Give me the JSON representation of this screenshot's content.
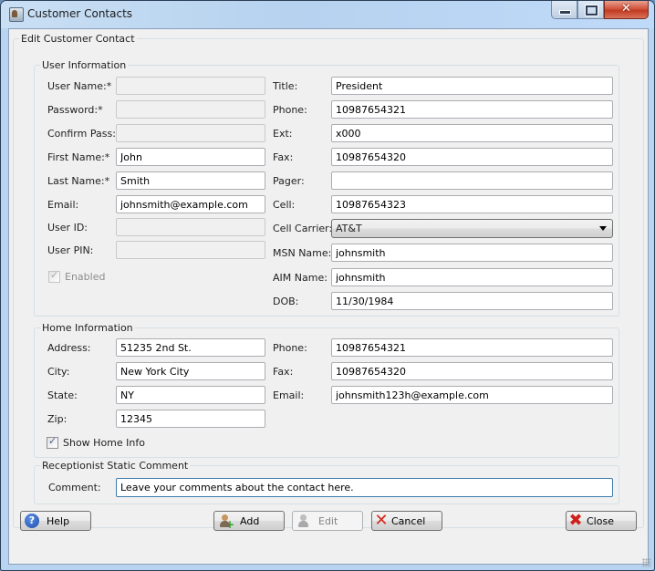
{
  "window": {
    "title": "Customer Contacts",
    "icon": "contacts-app-icon",
    "controls": {
      "minimize": "minimize-icon",
      "maximize": "maximize-icon",
      "close": "close-icon",
      "close_glyph": "✕"
    }
  },
  "main_group": {
    "legend": "Edit Customer Contact"
  },
  "user_info": {
    "legend": "User Information",
    "left_fields": [
      {
        "label": "User Name:*",
        "value": "",
        "enabled": false
      },
      {
        "label": "Password:*",
        "value": "",
        "enabled": false
      },
      {
        "label": "Confirm Pass:*",
        "value": "",
        "enabled": false
      },
      {
        "label": "First Name:*",
        "value": "John",
        "enabled": true
      },
      {
        "label": "Last Name:*",
        "value": "Smith",
        "enabled": true
      },
      {
        "label": "Email:",
        "value": "johnsmith@example.com",
        "enabled": true
      },
      {
        "label": "User ID:",
        "value": "",
        "enabled": false
      },
      {
        "label": "User PIN:",
        "value": "",
        "enabled": false
      }
    ],
    "enabled_checkbox": {
      "label": "Enabled",
      "checked": true,
      "disabled": true
    },
    "right_fields": [
      {
        "label": "Title:",
        "value": "President"
      },
      {
        "label": "Phone:",
        "value": "10987654321"
      },
      {
        "label": "Ext:",
        "value": "x000"
      },
      {
        "label": "Fax:",
        "value": "10987654320"
      },
      {
        "label": "Pager:",
        "value": ""
      },
      {
        "label": "Cell:",
        "value": "10987654323"
      }
    ],
    "cell_carrier": {
      "label": "Cell Carrier:",
      "selected": "AT&T"
    },
    "right_fields_2": [
      {
        "label": "MSN Name:",
        "value": "johnsmith"
      },
      {
        "label": "AIM Name:",
        "value": "johnsmith"
      },
      {
        "label": "DOB:",
        "value": "11/30/1984"
      }
    ]
  },
  "home_info": {
    "legend": "Home Information",
    "left_fields": [
      {
        "label": "Address:",
        "value": "51235 2nd St."
      },
      {
        "label": "City:",
        "value": "New York City"
      },
      {
        "label": "State:",
        "value": "NY"
      },
      {
        "label": "Zip:",
        "value": "12345"
      }
    ],
    "right_fields": [
      {
        "label": "Phone:",
        "value": "10987654321"
      },
      {
        "label": "Fax:",
        "value": "10987654320"
      },
      {
        "label": "Email:",
        "value": "johnsmith123h@example.com"
      }
    ],
    "show_home_checkbox": {
      "label": "Show Home Info",
      "checked": true
    }
  },
  "comment_group": {
    "legend": "Receptionist Static Comment",
    "label": "Comment:",
    "value": "Leave your comments about the contact here."
  },
  "buttons": {
    "help": "Help",
    "add": "Add",
    "edit": "Edit",
    "cancel": "Cancel",
    "close": "Close"
  }
}
